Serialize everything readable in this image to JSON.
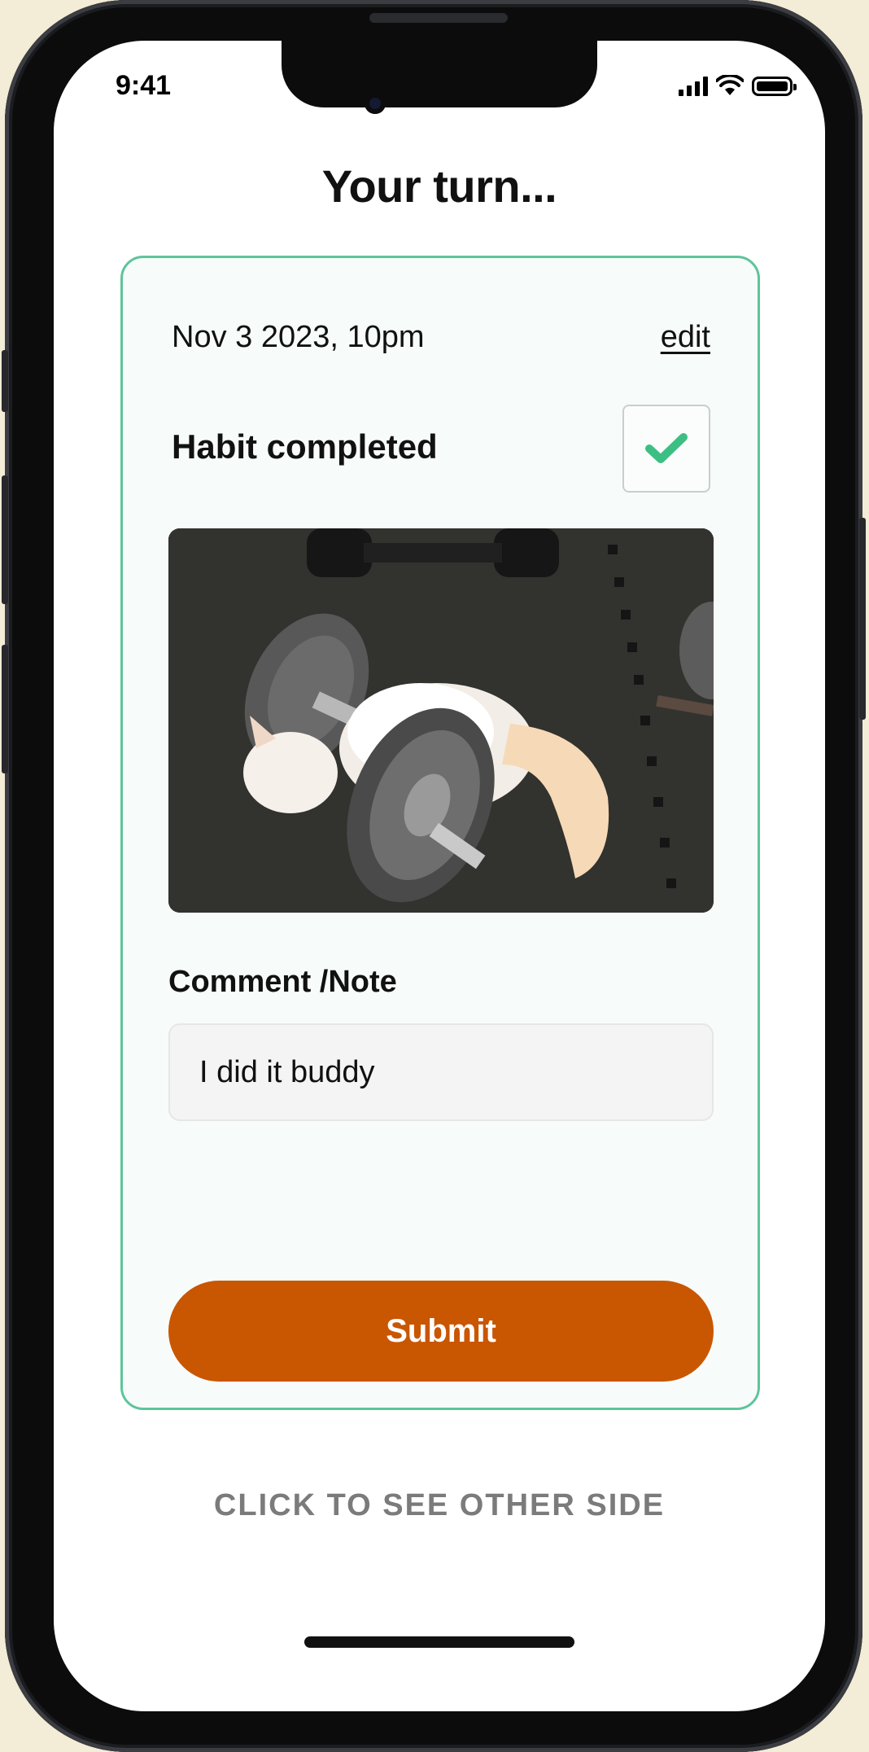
{
  "status_bar": {
    "time": "9:41"
  },
  "page": {
    "title": "Your turn..."
  },
  "card": {
    "date": "Nov 3 2023, 10pm",
    "edit_label": "edit",
    "habit_label": "Habit completed",
    "habit_completed": true,
    "photo_alt": "kitten sleeping on a dumbbell",
    "comment_label": "Comment /Note",
    "comment_value": "I did it buddy",
    "submit_label": "Submit"
  },
  "footer": {
    "flip_label": "CLICK TO SEE OTHER SIDE"
  },
  "colors": {
    "accent_border": "#5ec49b",
    "check": "#3dbf84",
    "submit": "#c95600"
  }
}
